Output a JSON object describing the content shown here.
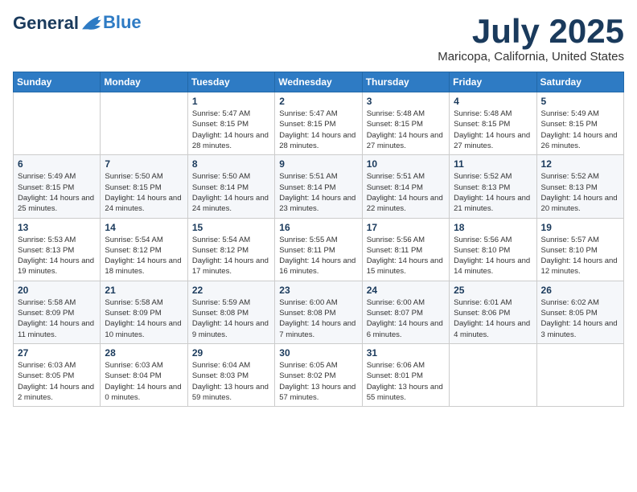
{
  "header": {
    "logo_general": "General",
    "logo_blue": "Blue",
    "month": "July 2025",
    "location": "Maricopa, California, United States"
  },
  "days_of_week": [
    "Sunday",
    "Monday",
    "Tuesday",
    "Wednesday",
    "Thursday",
    "Friday",
    "Saturday"
  ],
  "weeks": [
    [
      {
        "day": "",
        "content": ""
      },
      {
        "day": "",
        "content": ""
      },
      {
        "day": "1",
        "content": "Sunrise: 5:47 AM\nSunset: 8:15 PM\nDaylight: 14 hours and 28 minutes."
      },
      {
        "day": "2",
        "content": "Sunrise: 5:47 AM\nSunset: 8:15 PM\nDaylight: 14 hours and 28 minutes."
      },
      {
        "day": "3",
        "content": "Sunrise: 5:48 AM\nSunset: 8:15 PM\nDaylight: 14 hours and 27 minutes."
      },
      {
        "day": "4",
        "content": "Sunrise: 5:48 AM\nSunset: 8:15 PM\nDaylight: 14 hours and 27 minutes."
      },
      {
        "day": "5",
        "content": "Sunrise: 5:49 AM\nSunset: 8:15 PM\nDaylight: 14 hours and 26 minutes."
      }
    ],
    [
      {
        "day": "6",
        "content": "Sunrise: 5:49 AM\nSunset: 8:15 PM\nDaylight: 14 hours and 25 minutes."
      },
      {
        "day": "7",
        "content": "Sunrise: 5:50 AM\nSunset: 8:15 PM\nDaylight: 14 hours and 24 minutes."
      },
      {
        "day": "8",
        "content": "Sunrise: 5:50 AM\nSunset: 8:14 PM\nDaylight: 14 hours and 24 minutes."
      },
      {
        "day": "9",
        "content": "Sunrise: 5:51 AM\nSunset: 8:14 PM\nDaylight: 14 hours and 23 minutes."
      },
      {
        "day": "10",
        "content": "Sunrise: 5:51 AM\nSunset: 8:14 PM\nDaylight: 14 hours and 22 minutes."
      },
      {
        "day": "11",
        "content": "Sunrise: 5:52 AM\nSunset: 8:13 PM\nDaylight: 14 hours and 21 minutes."
      },
      {
        "day": "12",
        "content": "Sunrise: 5:52 AM\nSunset: 8:13 PM\nDaylight: 14 hours and 20 minutes."
      }
    ],
    [
      {
        "day": "13",
        "content": "Sunrise: 5:53 AM\nSunset: 8:13 PM\nDaylight: 14 hours and 19 minutes."
      },
      {
        "day": "14",
        "content": "Sunrise: 5:54 AM\nSunset: 8:12 PM\nDaylight: 14 hours and 18 minutes."
      },
      {
        "day": "15",
        "content": "Sunrise: 5:54 AM\nSunset: 8:12 PM\nDaylight: 14 hours and 17 minutes."
      },
      {
        "day": "16",
        "content": "Sunrise: 5:55 AM\nSunset: 8:11 PM\nDaylight: 14 hours and 16 minutes."
      },
      {
        "day": "17",
        "content": "Sunrise: 5:56 AM\nSunset: 8:11 PM\nDaylight: 14 hours and 15 minutes."
      },
      {
        "day": "18",
        "content": "Sunrise: 5:56 AM\nSunset: 8:10 PM\nDaylight: 14 hours and 14 minutes."
      },
      {
        "day": "19",
        "content": "Sunrise: 5:57 AM\nSunset: 8:10 PM\nDaylight: 14 hours and 12 minutes."
      }
    ],
    [
      {
        "day": "20",
        "content": "Sunrise: 5:58 AM\nSunset: 8:09 PM\nDaylight: 14 hours and 11 minutes."
      },
      {
        "day": "21",
        "content": "Sunrise: 5:58 AM\nSunset: 8:09 PM\nDaylight: 14 hours and 10 minutes."
      },
      {
        "day": "22",
        "content": "Sunrise: 5:59 AM\nSunset: 8:08 PM\nDaylight: 14 hours and 9 minutes."
      },
      {
        "day": "23",
        "content": "Sunrise: 6:00 AM\nSunset: 8:08 PM\nDaylight: 14 hours and 7 minutes."
      },
      {
        "day": "24",
        "content": "Sunrise: 6:00 AM\nSunset: 8:07 PM\nDaylight: 14 hours and 6 minutes."
      },
      {
        "day": "25",
        "content": "Sunrise: 6:01 AM\nSunset: 8:06 PM\nDaylight: 14 hours and 4 minutes."
      },
      {
        "day": "26",
        "content": "Sunrise: 6:02 AM\nSunset: 8:05 PM\nDaylight: 14 hours and 3 minutes."
      }
    ],
    [
      {
        "day": "27",
        "content": "Sunrise: 6:03 AM\nSunset: 8:05 PM\nDaylight: 14 hours and 2 minutes."
      },
      {
        "day": "28",
        "content": "Sunrise: 6:03 AM\nSunset: 8:04 PM\nDaylight: 14 hours and 0 minutes."
      },
      {
        "day": "29",
        "content": "Sunrise: 6:04 AM\nSunset: 8:03 PM\nDaylight: 13 hours and 59 minutes."
      },
      {
        "day": "30",
        "content": "Sunrise: 6:05 AM\nSunset: 8:02 PM\nDaylight: 13 hours and 57 minutes."
      },
      {
        "day": "31",
        "content": "Sunrise: 6:06 AM\nSunset: 8:01 PM\nDaylight: 13 hours and 55 minutes."
      },
      {
        "day": "",
        "content": ""
      },
      {
        "day": "",
        "content": ""
      }
    ]
  ]
}
